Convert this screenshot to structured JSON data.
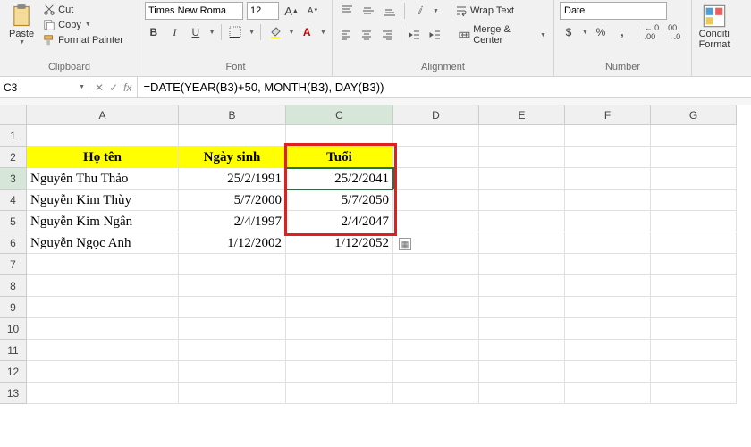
{
  "ribbon": {
    "clipboard": {
      "paste": "Paste",
      "cut": "Cut",
      "copy": "Copy",
      "format_painter": "Format Painter",
      "group_label": "Clipboard"
    },
    "font": {
      "name": "Times New Roma",
      "size": "12",
      "bold": "B",
      "italic": "I",
      "underline": "U",
      "group_label": "Font"
    },
    "alignment": {
      "wrap_text": "Wrap Text",
      "merge_center": "Merge & Center",
      "group_label": "Alignment"
    },
    "number": {
      "format": "Date",
      "currency": "$",
      "percent": "%",
      "comma": ",",
      "inc_dec": ".0",
      "dec_dec": ".00",
      "group_label": "Number"
    },
    "styles": {
      "cond_format": "Conditi\nFormat"
    }
  },
  "formula_bar": {
    "cell_ref": "C3",
    "formula": "=DATE(YEAR(B3)+50, MONTH(B3), DAY(B3))",
    "fx": "fx"
  },
  "grid": {
    "columns": [
      "A",
      "B",
      "C",
      "D",
      "E",
      "F",
      "G"
    ],
    "row_numbers": [
      "1",
      "2",
      "3",
      "4",
      "5",
      "6",
      "7",
      "8",
      "9",
      "10",
      "11",
      "12",
      "13"
    ],
    "headers": {
      "A": "Họ tên",
      "B": "Ngày sinh",
      "C": "Tuổi"
    },
    "rows": [
      {
        "A": "Nguyễn Thu Thảo",
        "B": "25/2/1991",
        "C": "25/2/2041"
      },
      {
        "A": "Nguyễn Kim Thùy",
        "B": "5/7/2000",
        "C": "5/7/2050"
      },
      {
        "A": "Nguyễn Kim Ngân",
        "B": "2/4/1997",
        "C": "2/4/2047"
      },
      {
        "A": "Nguyễn Ngọc Anh",
        "B": "1/12/2002",
        "C": "1/12/2052"
      }
    ]
  }
}
